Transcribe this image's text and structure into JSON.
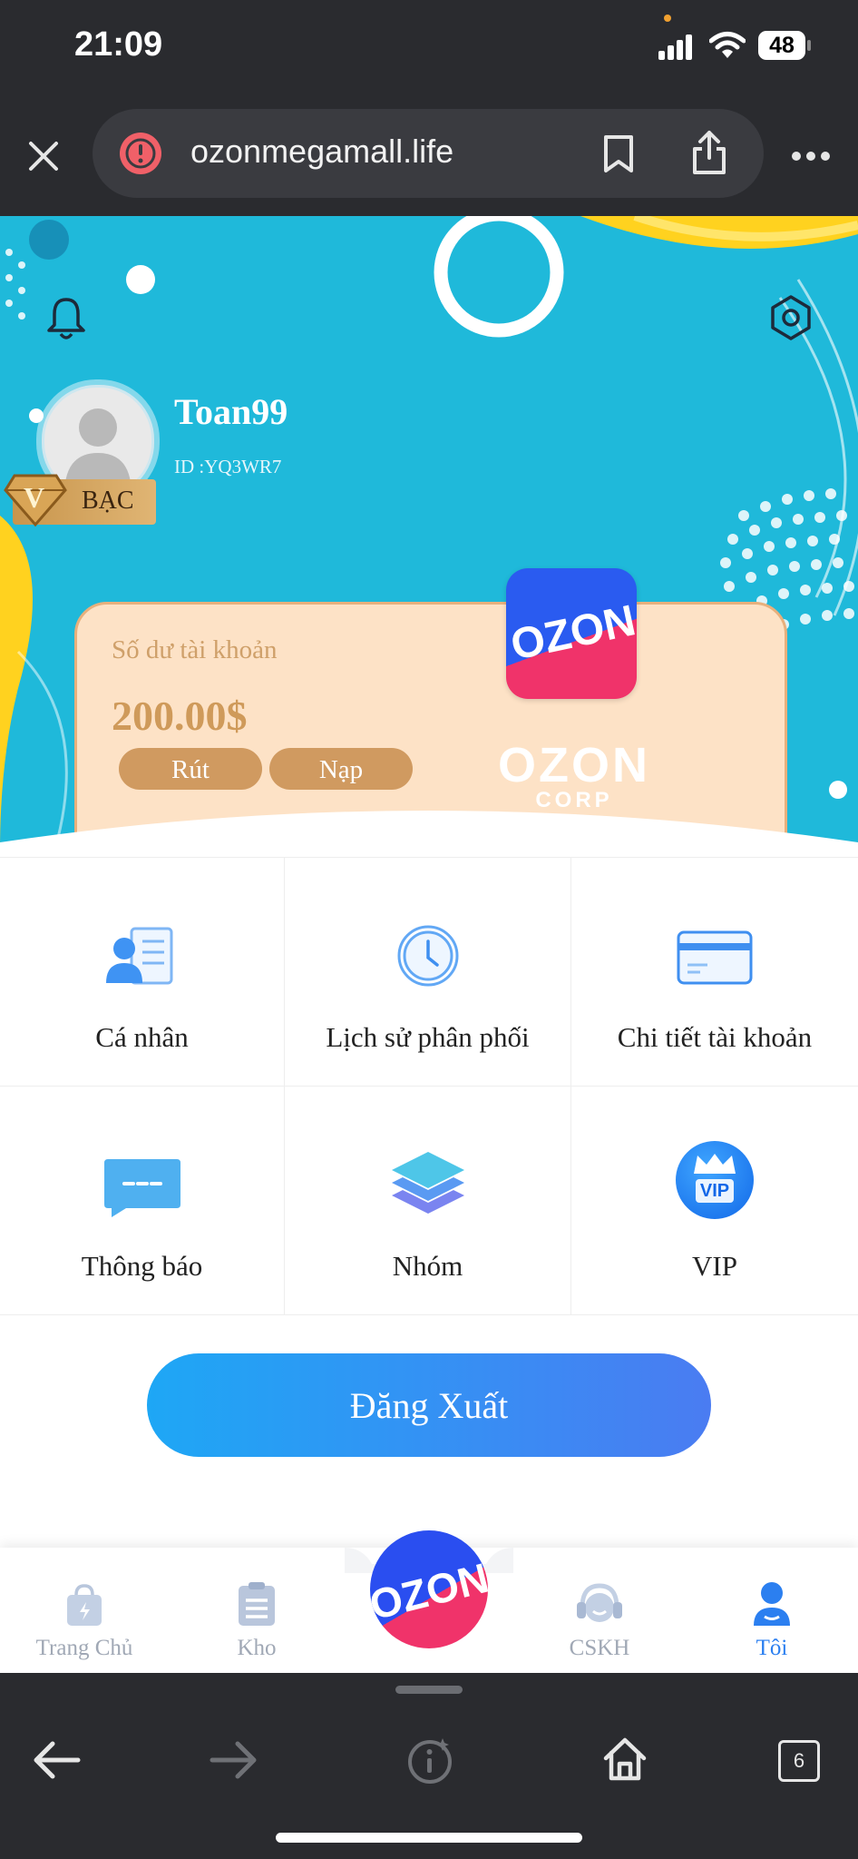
{
  "status_bar": {
    "time": "21:09",
    "battery": "48"
  },
  "browser": {
    "url": "ozonmegamall.life"
  },
  "profile": {
    "username": "Toan99",
    "user_id": "ID :YQ3WR7",
    "tier_badge": "BẠC",
    "tier_letter": "V"
  },
  "balance_card": {
    "label": "Số dư tài khoản",
    "amount": "200.00$",
    "withdraw_label": "Rút",
    "deposit_label": "Nạp",
    "logo_text": "OZON",
    "brand_text": "OZON",
    "brand_sub": "CORP"
  },
  "menu": {
    "personal": "Cá nhân",
    "history": "Lịch sử phân phối",
    "account_details": "Chi tiết tài khoản",
    "notifications": "Thông báo",
    "group": "Nhóm",
    "vip": "VIP",
    "vip_icon_text": "VIP"
  },
  "logout_label": "Đăng Xuất",
  "tabbar": {
    "home": "Trang Chủ",
    "warehouse": "Kho",
    "center_logo": "OZON",
    "support": "CSKH",
    "me": "Tôi"
  },
  "bottom_bar": {
    "tabs_count": "6"
  },
  "colors": {
    "hero_bg": "#1fb9da",
    "accent_blue": "#1e88e5",
    "card_bg": "#fde2c6",
    "button_tan": "#d09a60"
  }
}
